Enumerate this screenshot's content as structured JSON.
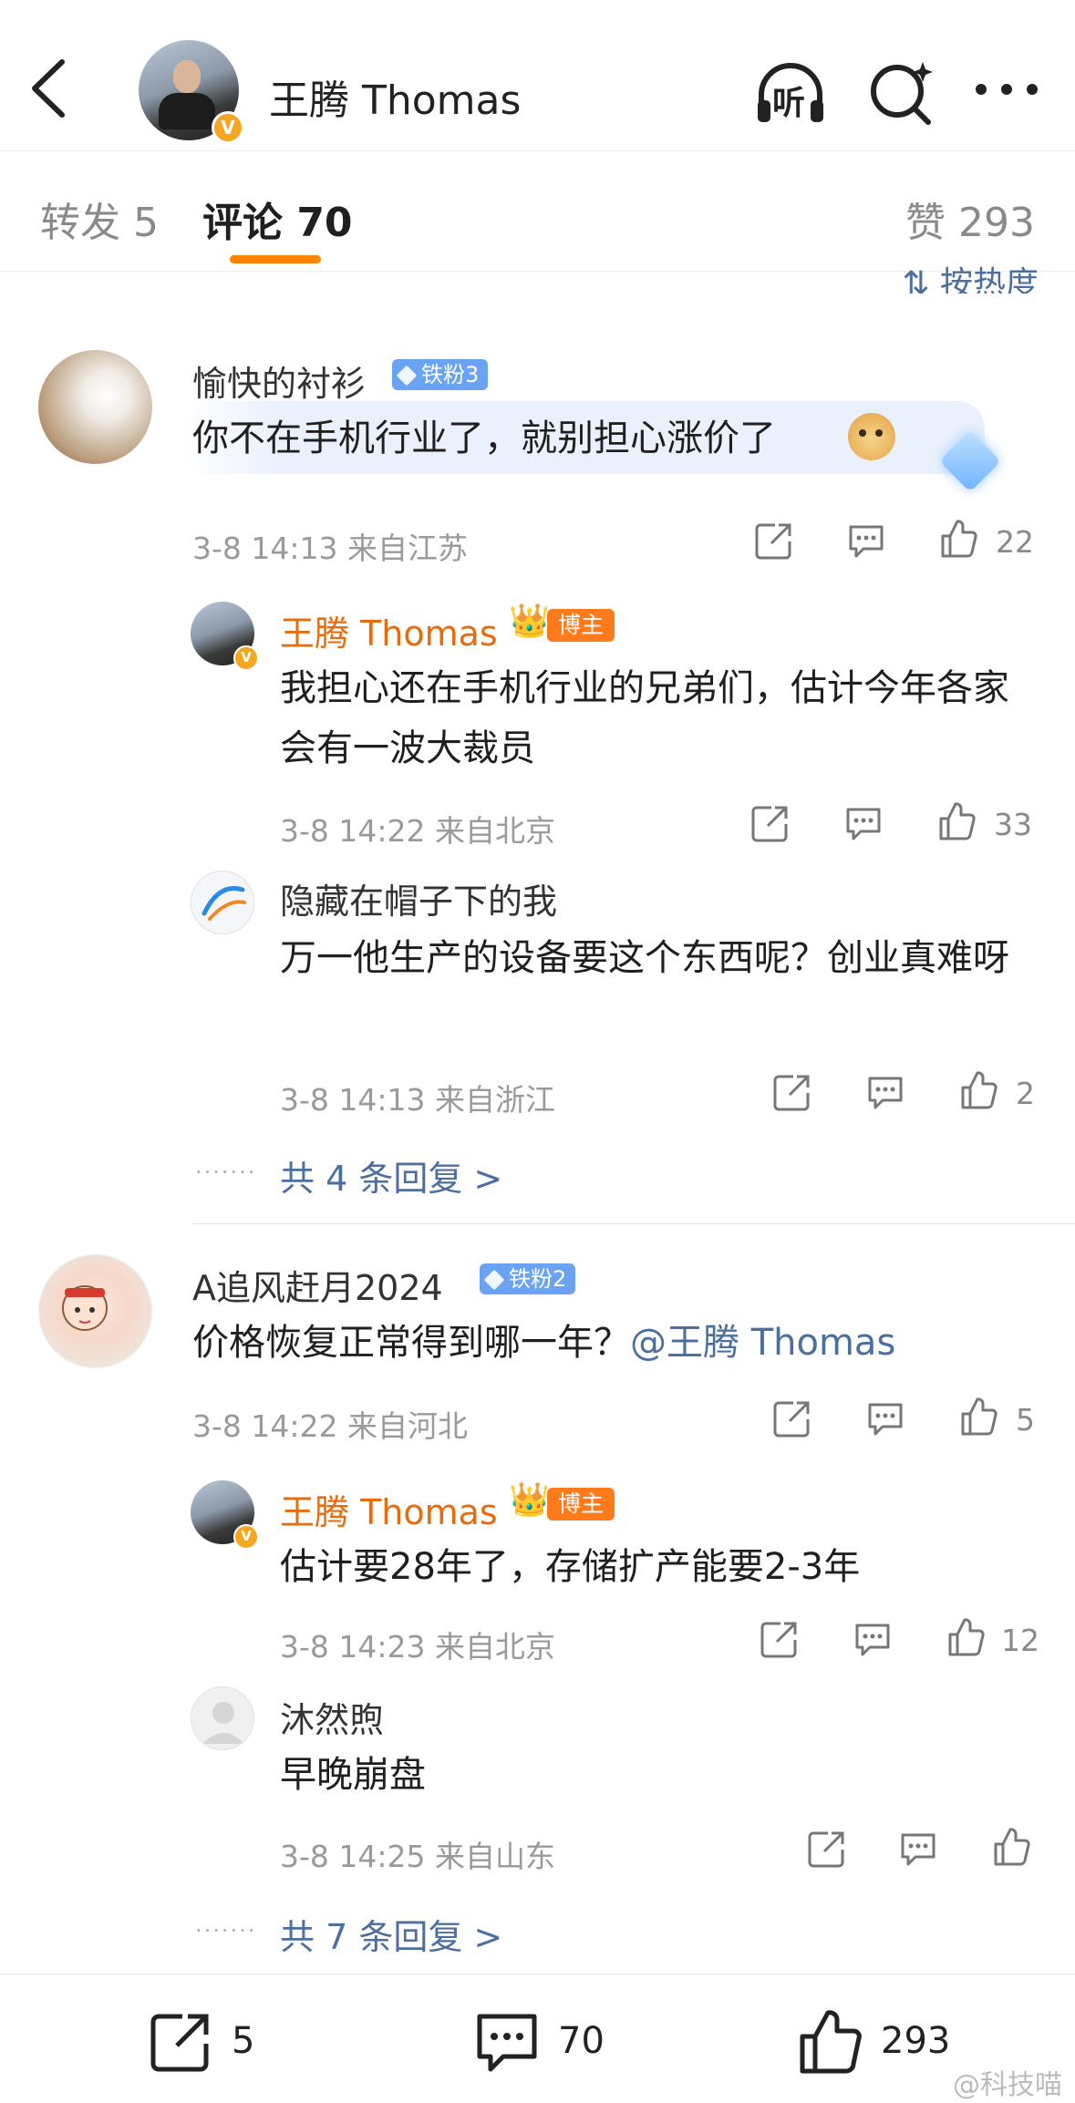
{
  "header": {
    "back_icon": "chevron-left-icon",
    "user_name": "王腾 Thomas",
    "listen_label": "听",
    "search_icon": "search-sparkle-icon",
    "more_icon": "more-horizontal-icon"
  },
  "tabs": {
    "repost": "转发 5",
    "comments": "评论 70",
    "likes": "赞 293",
    "active": "comments",
    "accent_color": "#ff8200"
  },
  "sort": {
    "label": "按热度"
  },
  "comments": [
    {
      "user": "愉快的衬衫",
      "fan_badge": "铁粉3",
      "text": "你不在手机行业了，就别担心涨价了",
      "time": "3-8 14:13",
      "location": "来自江苏",
      "likes": "22",
      "replies": [
        {
          "user": "王腾 Thomas",
          "badge": "博主",
          "text": "我担心还在手机行业的兄弟们，估计今年各家会有一波大裁员",
          "time": "3-8 14:22",
          "location": "来自北京",
          "likes": "33"
        },
        {
          "user": "隐藏在帽子下的我",
          "text": "万一他生产的设备要这个东西呢？创业真难呀",
          "time": "3-8 14:13",
          "location": "来自浙江",
          "likes": "2"
        }
      ],
      "more_replies": "共 4 条回复 >"
    },
    {
      "user": "A追风赶月2024",
      "fan_badge": "铁粉2",
      "text": "价格恢复正常得到哪一年？",
      "mention": "@王腾 Thomas",
      "time": "3-8 14:22",
      "location": "来自河北",
      "likes": "5",
      "replies": [
        {
          "user": "王腾 Thomas",
          "badge": "博主",
          "text": "估计要28年了，存储扩产能要2-3年",
          "time": "3-8 14:23",
          "location": "来自北京",
          "likes": "12"
        },
        {
          "user": "沐然煦",
          "text": "早晚崩盘",
          "time": "3-8 14:25",
          "location": "来自山东",
          "likes": ""
        }
      ],
      "more_replies": "共 7 条回复 >"
    }
  ],
  "bottom_bar": {
    "reposts": "5",
    "comments": "70",
    "likes": "293"
  },
  "watermark": "@科技喵",
  "colors": {
    "author_name": "#e86b0c",
    "link": "#4c6fa0",
    "fan_badge": "#6aa3f3",
    "blogger_badge": "#ff7a1a"
  }
}
